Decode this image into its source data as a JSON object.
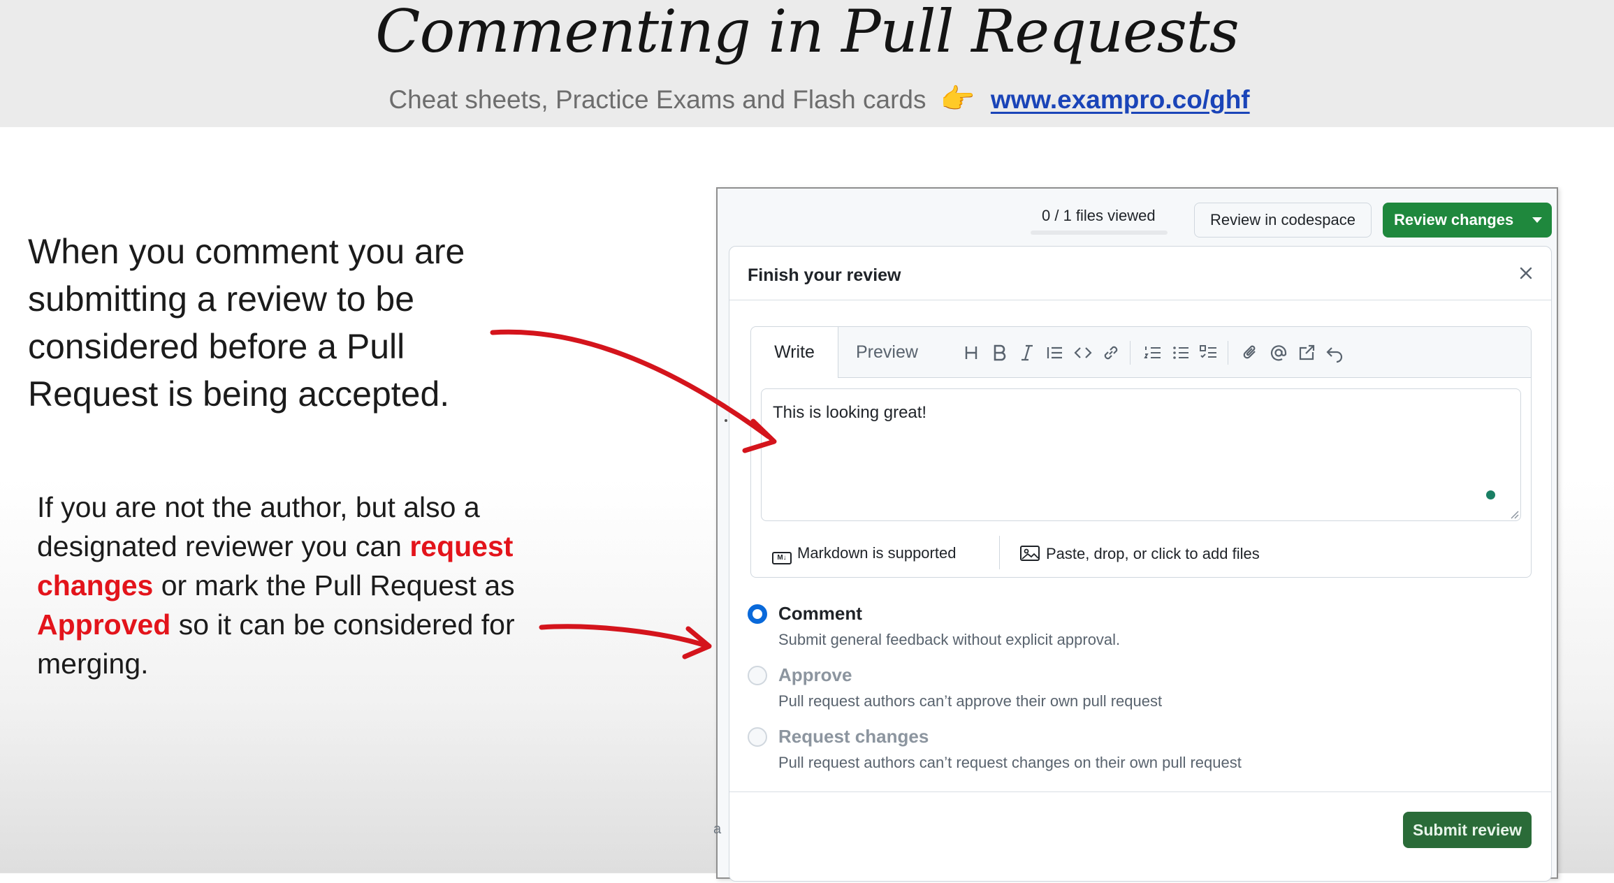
{
  "slide": {
    "title": "Commenting in Pull Requests",
    "subtitle": "Cheat sheets, Practice Exams and Flash cards",
    "pointer_emoji": "👉",
    "link": "www.exampro.co/ghf"
  },
  "explanation": {
    "para1": "When you comment you are submitting a review to be considered before a Pull Request is being accepted.",
    "para2_a": "If you are not the author, but also a designated reviewer you can ",
    "para2_hl1": "request changes",
    "para2_b": " or mark the Pull Request as ",
    "para2_hl2": "Approved",
    "para2_c": " so it can be considered for merging."
  },
  "github": {
    "files_viewed": "0 / 1 files viewed",
    "review_in_codespace": "Review in codespace",
    "review_changes": "Review changes",
    "popup": {
      "title": "Finish your review",
      "tabs": {
        "write": "Write",
        "preview": "Preview"
      },
      "toolbar_icons": [
        "heading-icon",
        "bold-icon",
        "italic-icon",
        "quote-icon",
        "code-icon",
        "link-icon",
        "ordered-list-icon",
        "unordered-list-icon",
        "task-list-icon",
        "attach-icon",
        "mention-icon",
        "reference-icon",
        "undo-icon"
      ],
      "comment_text": "This is looking great!",
      "markdown_hint": "Markdown is supported",
      "attach_hint": "Paste, drop, or click to add files",
      "options": [
        {
          "label": "Comment",
          "desc": "Submit general feedback without explicit approval.",
          "checked": true,
          "disabled": false
        },
        {
          "label": "Approve",
          "desc": "Pull request authors can’t approve their own pull request",
          "checked": false,
          "disabled": true
        },
        {
          "label": "Request changes",
          "desc": "Pull request authors can’t request changes on their own pull request",
          "checked": false,
          "disabled": true
        }
      ],
      "submit": "Submit review"
    },
    "stray_char": "a"
  },
  "colors": {
    "accent_red": "#e3141b",
    "github_green": "#1f883d",
    "radio_blue": "#0969da",
    "link_blue": "#1a44b8"
  }
}
